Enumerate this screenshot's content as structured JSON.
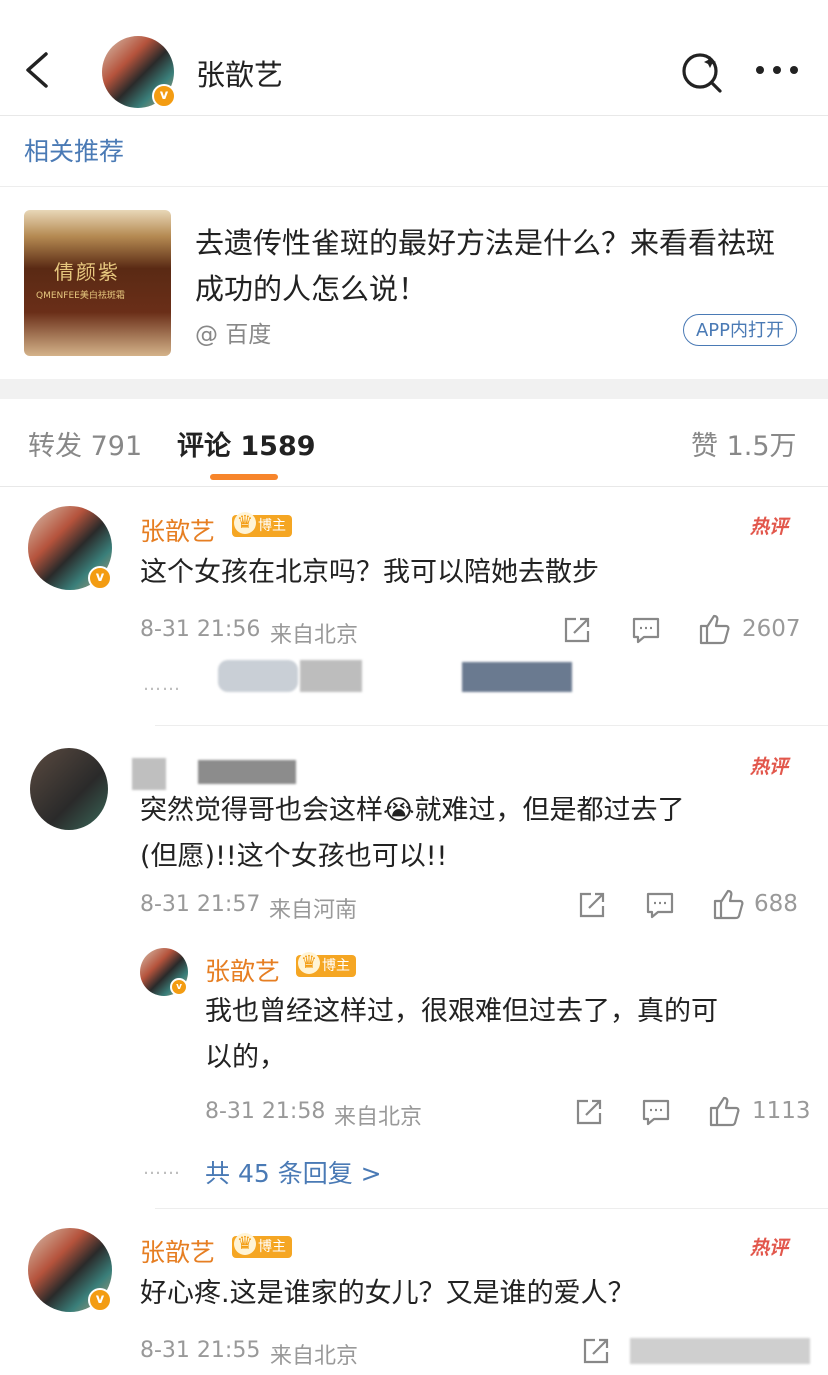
{
  "header": {
    "title": "张歆艺"
  },
  "section_label": "相关推荐",
  "ad": {
    "title": "去遗传性雀斑的最好方法是什么？来看看祛斑成功的人怎么说！",
    "source": "@ 百度",
    "open_button": "APP内打开",
    "image_brand": "倩颜紫",
    "image_brand_sub": "QMENFEE美白祛斑霜"
  },
  "tabs": {
    "repost": "转发 791",
    "comment": "评论 1589",
    "like": "赞 1.5万"
  },
  "comments": [
    {
      "name": "张歆艺",
      "badge": "博主",
      "hot": "热评",
      "text": "这个女孩在北京吗？我可以陪她去散步",
      "time": "8-31 21:56",
      "location": "来自北京",
      "likes": "2607",
      "dots": "……"
    },
    {
      "hot": "热评",
      "text_line1": "突然觉得哥也会这样😭就难过，但是都过去了",
      "text_line2": "(但愿)!!这个女孩也可以!!",
      "time": "8-31 21:57",
      "location": "来自河南",
      "likes": "688",
      "reply": {
        "name": "张歆艺",
        "badge": "博主",
        "text_line1": "我也曾经这样过，很艰难但过去了，真的可",
        "text_line2": "以的，",
        "time": "8-31 21:58",
        "location": "来自北京",
        "likes": "1113"
      },
      "more_replies": "共 45 条回复 >",
      "dots": "……"
    },
    {
      "name": "张歆艺",
      "badge": "博主",
      "hot": "热评",
      "text": "好心疼.这是谁家的女儿？又是谁的爱人？",
      "time": "8-31 21:55",
      "location": "来自北京"
    }
  ],
  "colors": {
    "accent": "#f7852b",
    "link": "#4a7ab5",
    "name": "#e67e22",
    "hot": "#e2574c"
  },
  "icons": [
    "back-icon",
    "search-icon",
    "more-icon",
    "repost-icon",
    "comment-icon",
    "like-icon"
  ]
}
